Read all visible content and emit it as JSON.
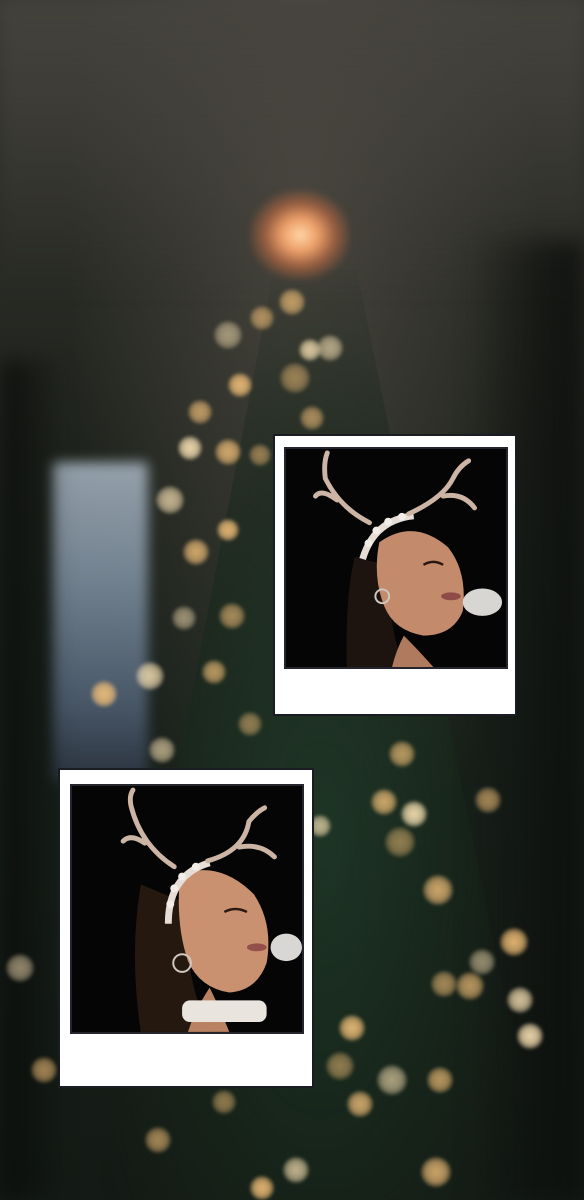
{
  "wallpaper": {
    "palette": {
      "bokeh_warm": "#f5c27a",
      "bokeh_bright": "#ffe7b8",
      "tree_green": "#1e3a28",
      "frame_white": "#ffffff",
      "photo_black": "#070707"
    },
    "polaroids": [
      {
        "label": "singer-reindeer-antlers-top",
        "icon": "photo-icon"
      },
      {
        "label": "singer-reindeer-antlers-bottom",
        "icon": "photo-icon"
      }
    ]
  }
}
